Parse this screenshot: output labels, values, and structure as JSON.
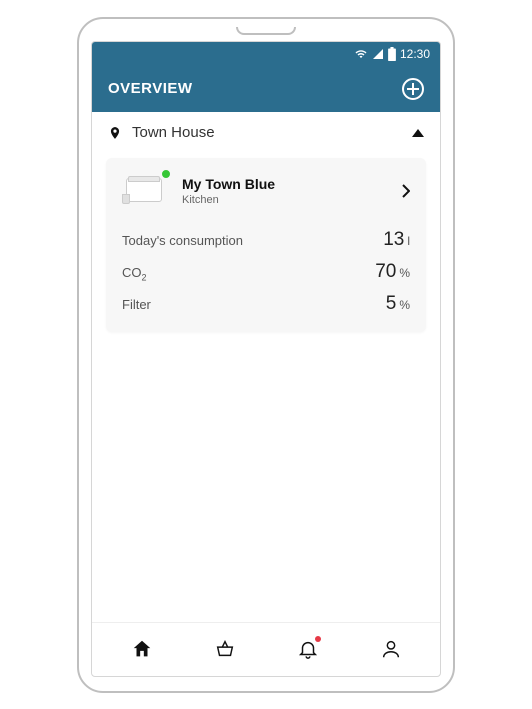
{
  "statusbar": {
    "time": "12:30"
  },
  "header": {
    "title": "OVERVIEW"
  },
  "location": {
    "name": "Town House"
  },
  "device": {
    "name": "My Town Blue",
    "room": "Kitchen"
  },
  "metrics": {
    "consumption_label": "Today's consumption",
    "consumption_value": "13",
    "consumption_unit": "l",
    "co2_label_main": "CO",
    "co2_label_sub": "2",
    "co2_value": "70",
    "co2_unit": "%",
    "filter_label": "Filter",
    "filter_value": "5",
    "filter_unit": "%"
  }
}
